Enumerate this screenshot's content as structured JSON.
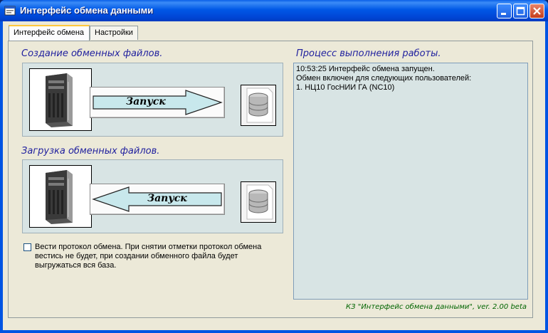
{
  "window": {
    "title": "Интерфейс обмена данными"
  },
  "tabs": [
    {
      "label": "Интерфейс обмена",
      "active": true
    },
    {
      "label": "Настройки",
      "active": false
    }
  ],
  "export_section": {
    "title": "Создание обменных файлов.",
    "button_label": "Запуск"
  },
  "import_section": {
    "title": "Загрузка обменных файлов.",
    "button_label": "Запуск"
  },
  "progress": {
    "title": "Процесс выполнения работы.",
    "lines": [
      "10:53:25 Интерфейс обмена запущен.",
      "Обмен включен для следующих пользователей:",
      "1. НЦ10 ГосНИИ ГА (NC10)"
    ]
  },
  "protocol_checkbox": {
    "checked": false,
    "label": "Вести протокол обмена. При снятии отметки протокол обмена вестись не будет, при создании обменного файла будет выгружаться вся база."
  },
  "footer": {
    "version_text": "КЗ \"Интерфейс обмена данными\", ver. 2.00 beta"
  },
  "colors": {
    "section_title": "#1f1f9e",
    "panel_bg": "#d8e4e4",
    "arrow_fill": "#c8e8ec",
    "footer_text": "#006400"
  },
  "icons": {
    "server": "server-tower-icon",
    "database": "database-icon"
  }
}
